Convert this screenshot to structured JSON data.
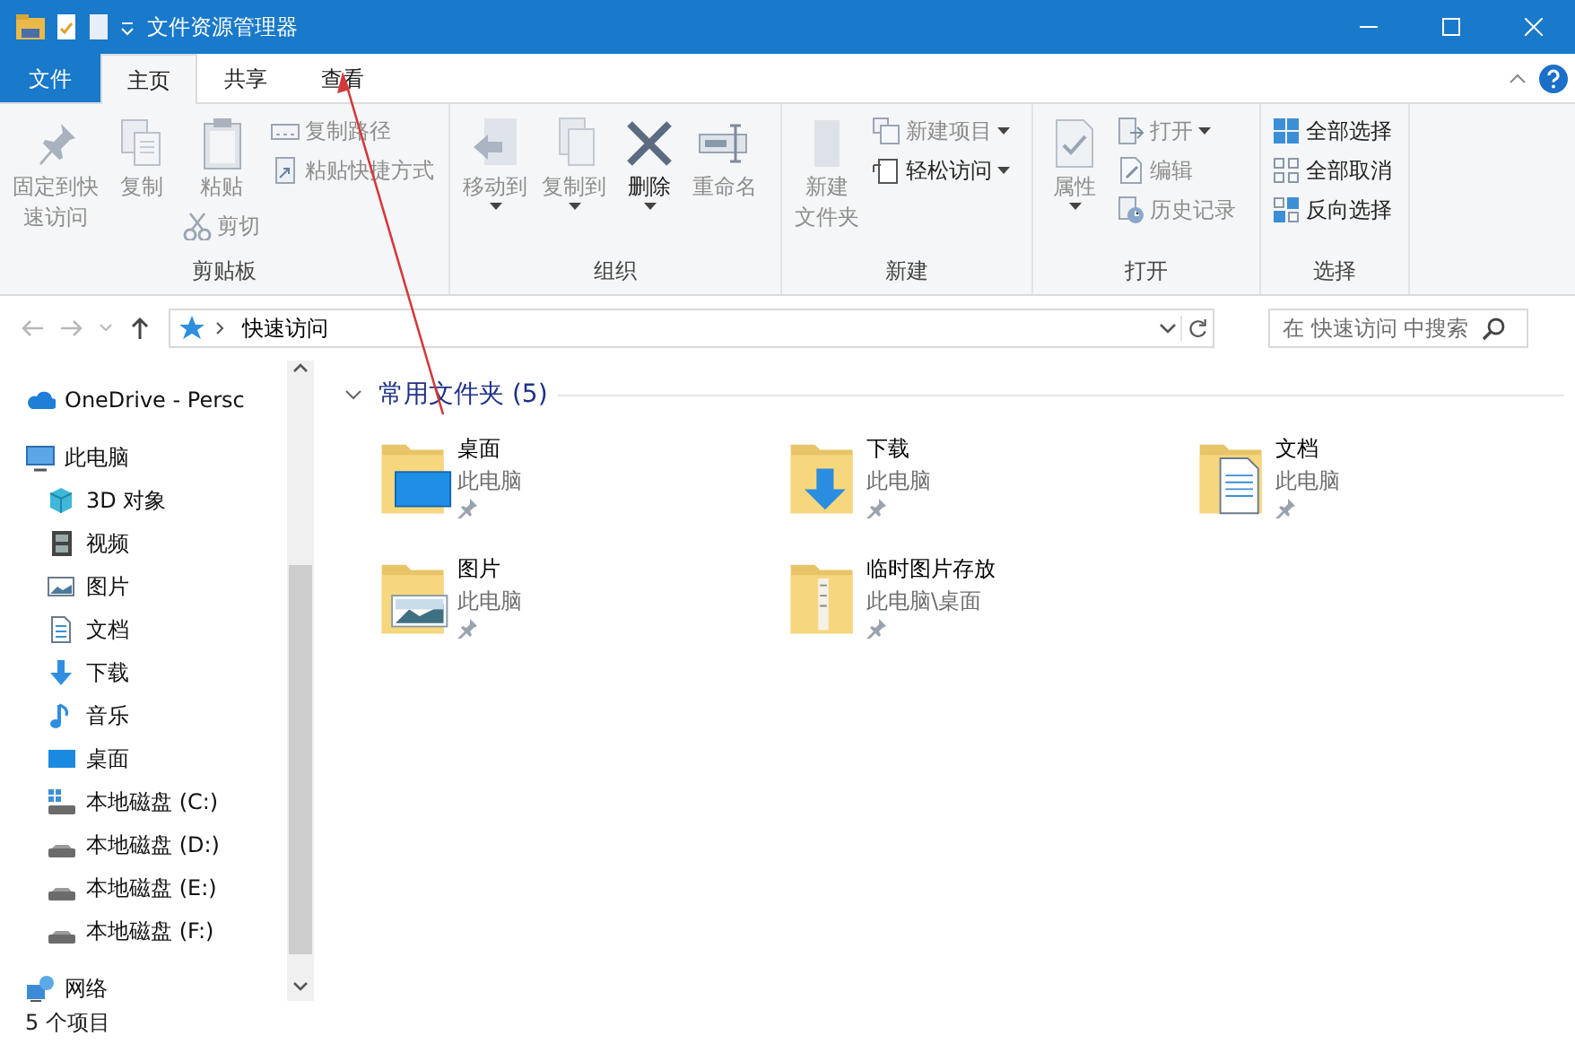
{
  "window": {
    "title": "文件资源管理器"
  },
  "ribbon_tabs": [
    {
      "label": "文件",
      "kind": "file",
      "selected": false
    },
    {
      "label": "主页",
      "kind": "tab",
      "selected": true
    },
    {
      "label": "共享",
      "kind": "tab",
      "selected": false
    },
    {
      "label": "查看",
      "kind": "tab",
      "selected": false
    }
  ],
  "ribbon_groups": [
    {
      "label": "剪贴板",
      "items": [
        {
          "lines": [
            "固定到快",
            "速访问"
          ],
          "kind": "large",
          "disabled": true,
          "dropdown": false
        },
        {
          "lines": [
            "复制"
          ],
          "kind": "large",
          "disabled": true,
          "dropdown": false
        },
        {
          "lines": [
            "粘贴"
          ],
          "kind": "large",
          "disabled": true,
          "dropdown": false
        },
        {
          "label": "剪切",
          "kind": "sub",
          "disabled": true,
          "dropdown": false
        },
        {
          "label": "复制路径",
          "kind": "small",
          "disabled": true,
          "dropdown": false
        },
        {
          "label": "粘贴快捷方式",
          "kind": "small",
          "disabled": true,
          "dropdown": false
        }
      ]
    },
    {
      "label": "组织",
      "items": [
        {
          "lines": [
            "移动到"
          ],
          "kind": "large",
          "disabled": true,
          "dropdown": true
        },
        {
          "lines": [
            "复制到"
          ],
          "kind": "large",
          "disabled": true,
          "dropdown": true
        },
        {
          "lines": [
            "删除"
          ],
          "kind": "large",
          "disabled": false,
          "dropdown": true
        },
        {
          "lines": [
            "重命名"
          ],
          "kind": "large",
          "disabled": true,
          "dropdown": false
        }
      ]
    },
    {
      "label": "新建",
      "items": [
        {
          "lines": [
            "新建",
            "文件夹"
          ],
          "kind": "large",
          "disabled": true,
          "dropdown": false
        },
        {
          "label": "新建项目",
          "kind": "small",
          "disabled": true,
          "dropdown": true
        },
        {
          "label": "轻松访问",
          "kind": "small",
          "disabled": false,
          "dropdown": true
        }
      ]
    },
    {
      "label": "打开",
      "items": [
        {
          "lines": [
            "属性"
          ],
          "kind": "large",
          "disabled": true,
          "dropdown": true
        },
        {
          "label": "打开",
          "kind": "small",
          "disabled": true,
          "dropdown": true
        },
        {
          "label": "编辑",
          "kind": "small",
          "disabled": true,
          "dropdown": false
        },
        {
          "label": "历史记录",
          "kind": "small",
          "disabled": true,
          "dropdown": false
        }
      ]
    },
    {
      "label": "选择",
      "items": [
        {
          "label": "全部选择",
          "kind": "small",
          "disabled": false,
          "dropdown": false
        },
        {
          "label": "全部取消",
          "kind": "small",
          "disabled": false,
          "dropdown": false
        },
        {
          "label": "反向选择",
          "kind": "small",
          "disabled": false,
          "dropdown": false
        }
      ]
    }
  ],
  "nav_buttons": [
    {
      "kind": "back",
      "disabled": true
    },
    {
      "kind": "forward",
      "disabled": true
    },
    {
      "kind": "recent",
      "disabled": true
    },
    {
      "kind": "up",
      "disabled": false
    }
  ],
  "address_bar": {
    "path": "快速访问"
  },
  "search": {
    "placeholder": "在 快速访问 中搜索"
  },
  "sidebar": {
    "items": [
      {
        "label": "OneDrive - Persc"
      },
      {
        "label": "此电脑",
        "children": [
          {
            "label": "3D 对象"
          },
          {
            "label": "视频"
          },
          {
            "label": "图片"
          },
          {
            "label": "文档"
          },
          {
            "label": "下载"
          },
          {
            "label": "音乐"
          },
          {
            "label": "桌面"
          },
          {
            "label": "本地磁盘 (C:)"
          },
          {
            "label": "本地磁盘 (D:)"
          },
          {
            "label": "本地磁盘 (E:)"
          },
          {
            "label": "本地磁盘 (F:)"
          }
        ]
      },
      {
        "label": "网络"
      }
    ]
  },
  "section": {
    "title": "常用文件夹 (5)",
    "expanded": true
  },
  "folders": [
    {
      "name": "桌面",
      "location": "此电脑",
      "pinned": true
    },
    {
      "name": "下载",
      "location": "此电脑",
      "pinned": true
    },
    {
      "name": "文档",
      "location": "此电脑",
      "pinned": true
    },
    {
      "name": "图片",
      "location": "此电脑",
      "pinned": true
    },
    {
      "name": "临时图片存放",
      "location": "此电脑\\桌面",
      "pinned": true
    }
  ],
  "status_bar": {
    "text": "5 个项目"
  }
}
